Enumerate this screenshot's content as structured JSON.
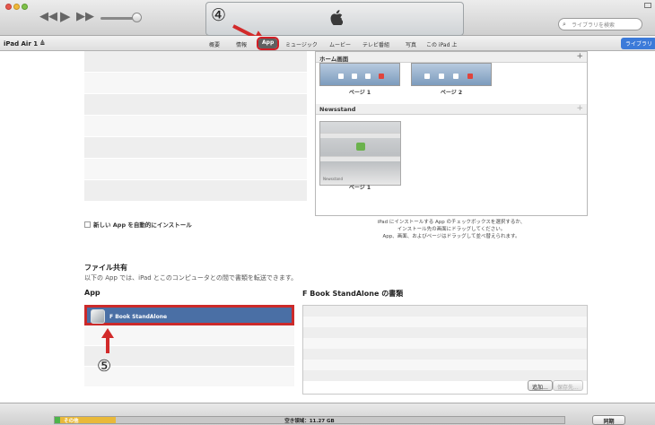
{
  "toolbar": {
    "search_placeholder": "ライブラリを検索"
  },
  "nav": {
    "device": "iPad Air 1 ≜",
    "tabs": [
      "概要",
      "情報",
      "App",
      "ミュージック",
      "ムービー",
      "テレビ番組",
      "写真",
      "この iPad 上"
    ],
    "active_tab": "App",
    "library_button": "ライブラリ"
  },
  "annotations": {
    "step4": "④",
    "step5": "⑤"
  },
  "apps": {
    "auto_install_label": "新しい App を自動的にインストール"
  },
  "home_screen": {
    "title": "ホーム画面",
    "pages": [
      "ページ 1",
      "ページ 2"
    ],
    "newsstand_title": "Newsstand",
    "newsstand_page": "ページ 1",
    "newsstand_thumb_label": "Newsstand",
    "help_lines": [
      "iPad にインストールする App のチェックボックスを選択するか、",
      "インストール先の画面にドラッグしてください。",
      "App、画面、およびページはドラッグして並べ替えられます。"
    ]
  },
  "file_sharing": {
    "title": "ファイル共有",
    "description": "以下の App では、iPad とこのコンピュータとの間で書類を転送できます。",
    "apps_header": "App",
    "docs_header": "F Book StandAlone の書類",
    "selected_app": "F Book StandAlone",
    "add_button": "追加...",
    "save_button": "保存先..."
  },
  "capacity": {
    "other_label": "その他",
    "free_text": "空き領域：11.27 GB",
    "sync_button": "同期"
  }
}
